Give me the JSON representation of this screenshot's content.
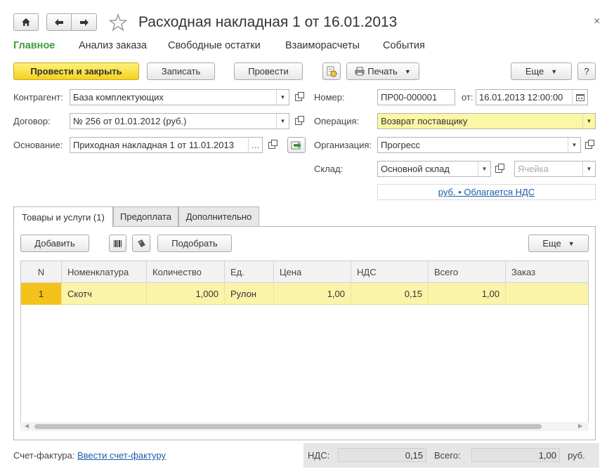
{
  "window": {
    "title": "Расходная накладная 1 от 16.01.2013",
    "close_glyph": "×"
  },
  "sections": [
    "Главное",
    "Анализ заказа",
    "Свободные остатки",
    "Взаиморасчеты",
    "События"
  ],
  "toolbar": {
    "post_and_close": "Провести и закрыть",
    "save": "Записать",
    "post": "Провести",
    "print": "Печать",
    "more": "Еще",
    "help": "?"
  },
  "form": {
    "counterparty_label": "Контрагент:",
    "counterparty_value": "База комплектующих",
    "contract_label": "Договор:",
    "contract_value": "№ 256 от 01.01.2012 (руб.)",
    "basis_label": "Основание:",
    "basis_value": "Приходная накладная 1 от 11.01.2013",
    "number_label": "Номер:",
    "number_value": "ПР00-000001",
    "date_label": "от:",
    "date_value": "16.01.2013 12:00:00",
    "operation_label": "Операция:",
    "operation_value": "Возврат поставщику",
    "organization_label": "Организация:",
    "organization_value": "Прогресс",
    "warehouse_label": "Склад:",
    "warehouse_value": "Основной склад",
    "cell_placeholder": "Ячейка",
    "vat_link": "руб. • Облагается НДС"
  },
  "tabs": [
    "Товары и услуги (1)",
    "Предоплата",
    "Дополнительно"
  ],
  "grid_toolbar": {
    "add": "Добавить",
    "select": "Подобрать",
    "more": "Еще"
  },
  "grid": {
    "columns": [
      "N",
      "Номенклатура",
      "Количество",
      "Ед.",
      "Цена",
      "НДС",
      "Всего",
      "Заказ"
    ],
    "rows": [
      [
        "1",
        "Скотч",
        "1,000",
        "Рулон",
        "1,00",
        "0,15",
        "1,00",
        ""
      ]
    ]
  },
  "footer": {
    "invoice_label": "Счет-фактура:",
    "invoice_link": "Ввести счет-фактуру",
    "vat_label": "НДС:",
    "vat_value": "0,15",
    "total_label": "Всего:",
    "total_value": "1,00",
    "currency": "руб."
  },
  "colors": {
    "accent_green": "#3f9b3f",
    "primary_button": "#f5d21f",
    "selected_row": "#fbf3a8",
    "highlight_field": "#fbf7a4",
    "link": "#1a5ea8"
  }
}
